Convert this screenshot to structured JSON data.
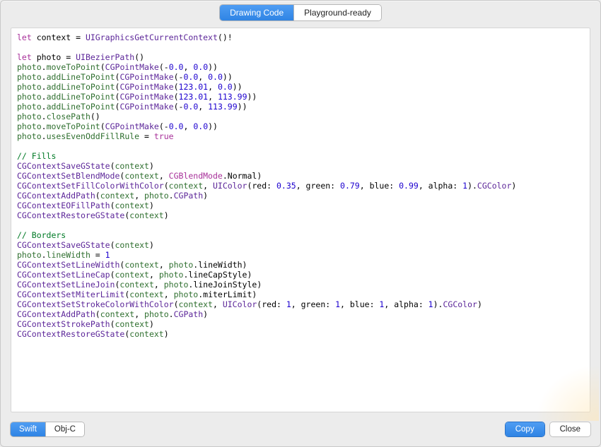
{
  "tabs": {
    "view": [
      "Drawing Code",
      "Playground-ready"
    ],
    "view_selected": 0,
    "lang": [
      "Swift",
      "Obj-C"
    ],
    "lang_selected": 0
  },
  "buttons": {
    "copy": "Copy",
    "close": "Close"
  },
  "code": {
    "l01": {
      "kw1": "let",
      "v": " context = ",
      "fn": "UIGraphicsGetCurrentContext",
      "suf": "()!"
    },
    "l02": "",
    "l03": {
      "kw1": "let",
      "v": " photo = ",
      "type": "UIBezierPath",
      "suf": "()"
    },
    "l04": {
      "obj": "photo",
      "dot": ".",
      "m": "moveToPoint",
      "open": "(",
      "fn": "CGPointMake",
      "args_open": "(-",
      "n1": "0.0",
      "c1": ", ",
      "n2": "0.0",
      "close": "))"
    },
    "l05": {
      "obj": "photo",
      "dot": ".",
      "m": "addLineToPoint",
      "open": "(",
      "fn": "CGPointMake",
      "args_open": "(-",
      "n1": "0.0",
      "c1": ", ",
      "n2": "0.0",
      "close": "))"
    },
    "l06": {
      "obj": "photo",
      "dot": ".",
      "m": "addLineToPoint",
      "open": "(",
      "fn": "CGPointMake",
      "args_open": "(",
      "n1": "123.01",
      "c1": ", ",
      "n2": "0.0",
      "close": "))"
    },
    "l07": {
      "obj": "photo",
      "dot": ".",
      "m": "addLineToPoint",
      "open": "(",
      "fn": "CGPointMake",
      "args_open": "(",
      "n1": "123.01",
      "c1": ", ",
      "n2": "113.99",
      "close": "))"
    },
    "l08": {
      "obj": "photo",
      "dot": ".",
      "m": "addLineToPoint",
      "open": "(",
      "fn": "CGPointMake",
      "args_open": "(-",
      "n1": "0.0",
      "c1": ", ",
      "n2": "113.99",
      "close": "))"
    },
    "l09": {
      "obj": "photo",
      "dot": ".",
      "m": "closePath",
      "suf": "()"
    },
    "l10": {
      "obj": "photo",
      "dot": ".",
      "m": "moveToPoint",
      "open": "(",
      "fn": "CGPointMake",
      "args_open": "(-",
      "n1": "0.0",
      "c1": ", ",
      "n2": "0.0",
      "close": "))"
    },
    "l11": {
      "obj": "photo",
      "dot": ".",
      "m": "usesEvenOddFillRule",
      "eq": " = ",
      "kw": "true"
    },
    "l12": "",
    "l13": "// Fills",
    "l14": {
      "fn": "CGContextSaveGState",
      "open": "(",
      "a": "context",
      "close": ")"
    },
    "l15": {
      "fn": "CGContextSetBlendMode",
      "open": "(",
      "a": "context",
      "c": ", ",
      "type": "CGBlendMode",
      "dot": ".",
      "mem": "Normal",
      "close": ")"
    },
    "l16": {
      "fn": "CGContextSetFillColorWithColor",
      "open": "(",
      "a": "context",
      "c": ", ",
      "type": "UIColor",
      "args": "(red: ",
      "n1": "0.35",
      "c1": ", green: ",
      "n2": "0.79",
      "c2": ", blue: ",
      "n3": "0.99",
      "c3": ", alpha: ",
      "n4": "1",
      "tail": ").",
      "prop": "CGColor",
      "close": ")"
    },
    "l17": {
      "fn": "CGContextAddPath",
      "open": "(",
      "a": "context",
      "c": ", ",
      "obj": "photo",
      "dot": ".",
      "prop": "CGPath",
      "close": ")"
    },
    "l18": {
      "fn": "CGContextEOFillPath",
      "open": "(",
      "a": "context",
      "close": ")"
    },
    "l19": {
      "fn": "CGContextRestoreGState",
      "open": "(",
      "a": "context",
      "close": ")"
    },
    "l20": "",
    "l21": "// Borders",
    "l22": {
      "fn": "CGContextSaveGState",
      "open": "(",
      "a": "context",
      "close": ")"
    },
    "l23": {
      "obj": "photo",
      "dot": ".",
      "m": "lineWidth",
      "eq": " = ",
      "n": "1"
    },
    "l24": {
      "fn": "CGContextSetLineWidth",
      "open": "(",
      "a": "context",
      "c": ", ",
      "obj": "photo",
      "dot": ".",
      "prop": "lineWidth",
      "close": ")"
    },
    "l25": {
      "fn": "CGContextSetLineCap",
      "open": "(",
      "a": "context",
      "c": ", ",
      "obj": "photo",
      "dot": ".",
      "prop": "lineCapStyle",
      "close": ")"
    },
    "l26": {
      "fn": "CGContextSetLineJoin",
      "open": "(",
      "a": "context",
      "c": ", ",
      "obj": "photo",
      "dot": ".",
      "prop": "lineJoinStyle",
      "close": ")"
    },
    "l27": {
      "fn": "CGContextSetMiterLimit",
      "open": "(",
      "a": "context",
      "c": ", ",
      "obj": "photo",
      "dot": ".",
      "prop": "miterLimit",
      "close": ")"
    },
    "l28": {
      "fn": "CGContextSetStrokeColorWithColor",
      "open": "(",
      "a": "context",
      "c": ", ",
      "type": "UIColor",
      "args": "(red: ",
      "n1": "1",
      "c1": ", green: ",
      "n2": "1",
      "c2": ", blue: ",
      "n3": "1",
      "c3": ", alpha: ",
      "n4": "1",
      "tail": ").",
      "prop": "CGColor",
      "close": ")"
    },
    "l29": {
      "fn": "CGContextAddPath",
      "open": "(",
      "a": "context",
      "c": ", ",
      "obj": "photo",
      "dot": ".",
      "prop": "CGPath",
      "close": ")"
    },
    "l30": {
      "fn": "CGContextStrokePath",
      "open": "(",
      "a": "context",
      "close": ")"
    },
    "l31": {
      "fn": "CGContextRestoreGState",
      "open": "(",
      "a": "context",
      "close": ")"
    }
  }
}
